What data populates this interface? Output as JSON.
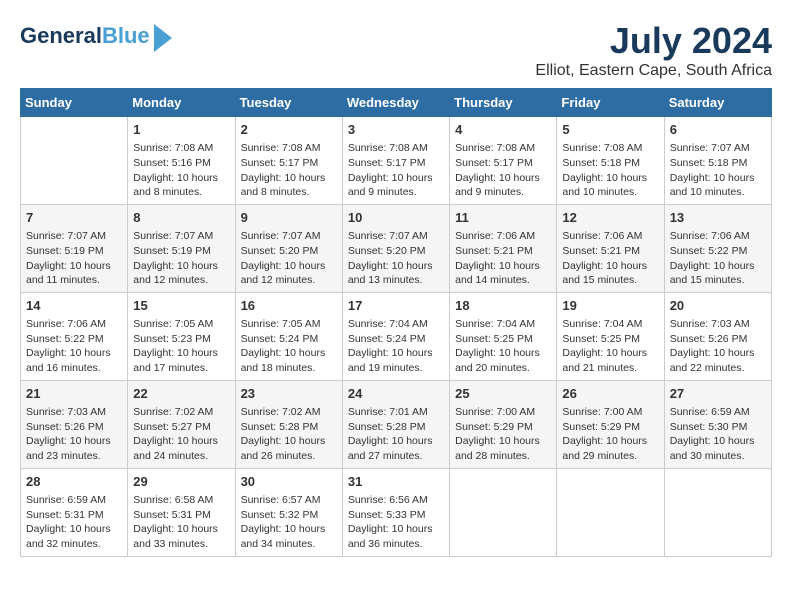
{
  "logo": {
    "line1": "General",
    "line2": "Blue"
  },
  "title": "July 2024",
  "location": "Elliot, Eastern Cape, South Africa",
  "days_of_week": [
    "Sunday",
    "Monday",
    "Tuesday",
    "Wednesday",
    "Thursday",
    "Friday",
    "Saturday"
  ],
  "weeks": [
    [
      {
        "num": "",
        "info": ""
      },
      {
        "num": "1",
        "info": "Sunrise: 7:08 AM\nSunset: 5:16 PM\nDaylight: 10 hours\nand 8 minutes."
      },
      {
        "num": "2",
        "info": "Sunrise: 7:08 AM\nSunset: 5:17 PM\nDaylight: 10 hours\nand 8 minutes."
      },
      {
        "num": "3",
        "info": "Sunrise: 7:08 AM\nSunset: 5:17 PM\nDaylight: 10 hours\nand 9 minutes."
      },
      {
        "num": "4",
        "info": "Sunrise: 7:08 AM\nSunset: 5:17 PM\nDaylight: 10 hours\nand 9 minutes."
      },
      {
        "num": "5",
        "info": "Sunrise: 7:08 AM\nSunset: 5:18 PM\nDaylight: 10 hours\nand 10 minutes."
      },
      {
        "num": "6",
        "info": "Sunrise: 7:07 AM\nSunset: 5:18 PM\nDaylight: 10 hours\nand 10 minutes."
      }
    ],
    [
      {
        "num": "7",
        "info": "Sunrise: 7:07 AM\nSunset: 5:19 PM\nDaylight: 10 hours\nand 11 minutes."
      },
      {
        "num": "8",
        "info": "Sunrise: 7:07 AM\nSunset: 5:19 PM\nDaylight: 10 hours\nand 12 minutes."
      },
      {
        "num": "9",
        "info": "Sunrise: 7:07 AM\nSunset: 5:20 PM\nDaylight: 10 hours\nand 12 minutes."
      },
      {
        "num": "10",
        "info": "Sunrise: 7:07 AM\nSunset: 5:20 PM\nDaylight: 10 hours\nand 13 minutes."
      },
      {
        "num": "11",
        "info": "Sunrise: 7:06 AM\nSunset: 5:21 PM\nDaylight: 10 hours\nand 14 minutes."
      },
      {
        "num": "12",
        "info": "Sunrise: 7:06 AM\nSunset: 5:21 PM\nDaylight: 10 hours\nand 15 minutes."
      },
      {
        "num": "13",
        "info": "Sunrise: 7:06 AM\nSunset: 5:22 PM\nDaylight: 10 hours\nand 15 minutes."
      }
    ],
    [
      {
        "num": "14",
        "info": "Sunrise: 7:06 AM\nSunset: 5:22 PM\nDaylight: 10 hours\nand 16 minutes."
      },
      {
        "num": "15",
        "info": "Sunrise: 7:05 AM\nSunset: 5:23 PM\nDaylight: 10 hours\nand 17 minutes."
      },
      {
        "num": "16",
        "info": "Sunrise: 7:05 AM\nSunset: 5:24 PM\nDaylight: 10 hours\nand 18 minutes."
      },
      {
        "num": "17",
        "info": "Sunrise: 7:04 AM\nSunset: 5:24 PM\nDaylight: 10 hours\nand 19 minutes."
      },
      {
        "num": "18",
        "info": "Sunrise: 7:04 AM\nSunset: 5:25 PM\nDaylight: 10 hours\nand 20 minutes."
      },
      {
        "num": "19",
        "info": "Sunrise: 7:04 AM\nSunset: 5:25 PM\nDaylight: 10 hours\nand 21 minutes."
      },
      {
        "num": "20",
        "info": "Sunrise: 7:03 AM\nSunset: 5:26 PM\nDaylight: 10 hours\nand 22 minutes."
      }
    ],
    [
      {
        "num": "21",
        "info": "Sunrise: 7:03 AM\nSunset: 5:26 PM\nDaylight: 10 hours\nand 23 minutes."
      },
      {
        "num": "22",
        "info": "Sunrise: 7:02 AM\nSunset: 5:27 PM\nDaylight: 10 hours\nand 24 minutes."
      },
      {
        "num": "23",
        "info": "Sunrise: 7:02 AM\nSunset: 5:28 PM\nDaylight: 10 hours\nand 26 minutes."
      },
      {
        "num": "24",
        "info": "Sunrise: 7:01 AM\nSunset: 5:28 PM\nDaylight: 10 hours\nand 27 minutes."
      },
      {
        "num": "25",
        "info": "Sunrise: 7:00 AM\nSunset: 5:29 PM\nDaylight: 10 hours\nand 28 minutes."
      },
      {
        "num": "26",
        "info": "Sunrise: 7:00 AM\nSunset: 5:29 PM\nDaylight: 10 hours\nand 29 minutes."
      },
      {
        "num": "27",
        "info": "Sunrise: 6:59 AM\nSunset: 5:30 PM\nDaylight: 10 hours\nand 30 minutes."
      }
    ],
    [
      {
        "num": "28",
        "info": "Sunrise: 6:59 AM\nSunset: 5:31 PM\nDaylight: 10 hours\nand 32 minutes."
      },
      {
        "num": "29",
        "info": "Sunrise: 6:58 AM\nSunset: 5:31 PM\nDaylight: 10 hours\nand 33 minutes."
      },
      {
        "num": "30",
        "info": "Sunrise: 6:57 AM\nSunset: 5:32 PM\nDaylight: 10 hours\nand 34 minutes."
      },
      {
        "num": "31",
        "info": "Sunrise: 6:56 AM\nSunset: 5:33 PM\nDaylight: 10 hours\nand 36 minutes."
      },
      {
        "num": "",
        "info": ""
      },
      {
        "num": "",
        "info": ""
      },
      {
        "num": "",
        "info": ""
      }
    ]
  ]
}
